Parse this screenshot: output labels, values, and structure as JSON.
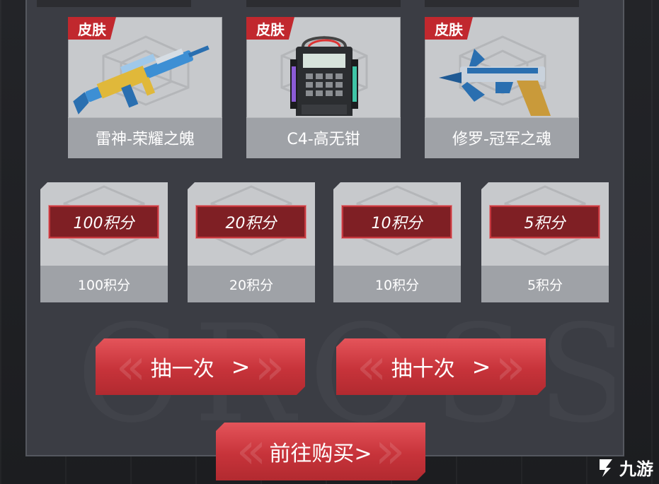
{
  "skins": [
    {
      "tag": "皮肤",
      "name": "雷神-荣耀之魄",
      "art": "rifle-icon"
    },
    {
      "tag": "皮肤",
      "name": "C4-高无钳",
      "art": "c4-bomb-icon"
    },
    {
      "tag": "皮肤",
      "name": "修罗-冠军之魂",
      "art": "pistol-icon"
    }
  ],
  "points": [
    {
      "badge": "100积分",
      "label": "100积分"
    },
    {
      "badge": "20积分",
      "label": "20积分"
    },
    {
      "badge": "10积分",
      "label": "10积分"
    },
    {
      "badge": "5积分",
      "label": "5积分"
    }
  ],
  "buttons": {
    "draw_once": "抽一次",
    "draw_ten": "抽十次",
    "arrow": ">",
    "buy": "前往购买>"
  },
  "watermark": {
    "logo_text": "九游"
  },
  "colors": {
    "accent": "#c1282e",
    "card": "#c7c9cc",
    "panel": "#3b3d44"
  }
}
